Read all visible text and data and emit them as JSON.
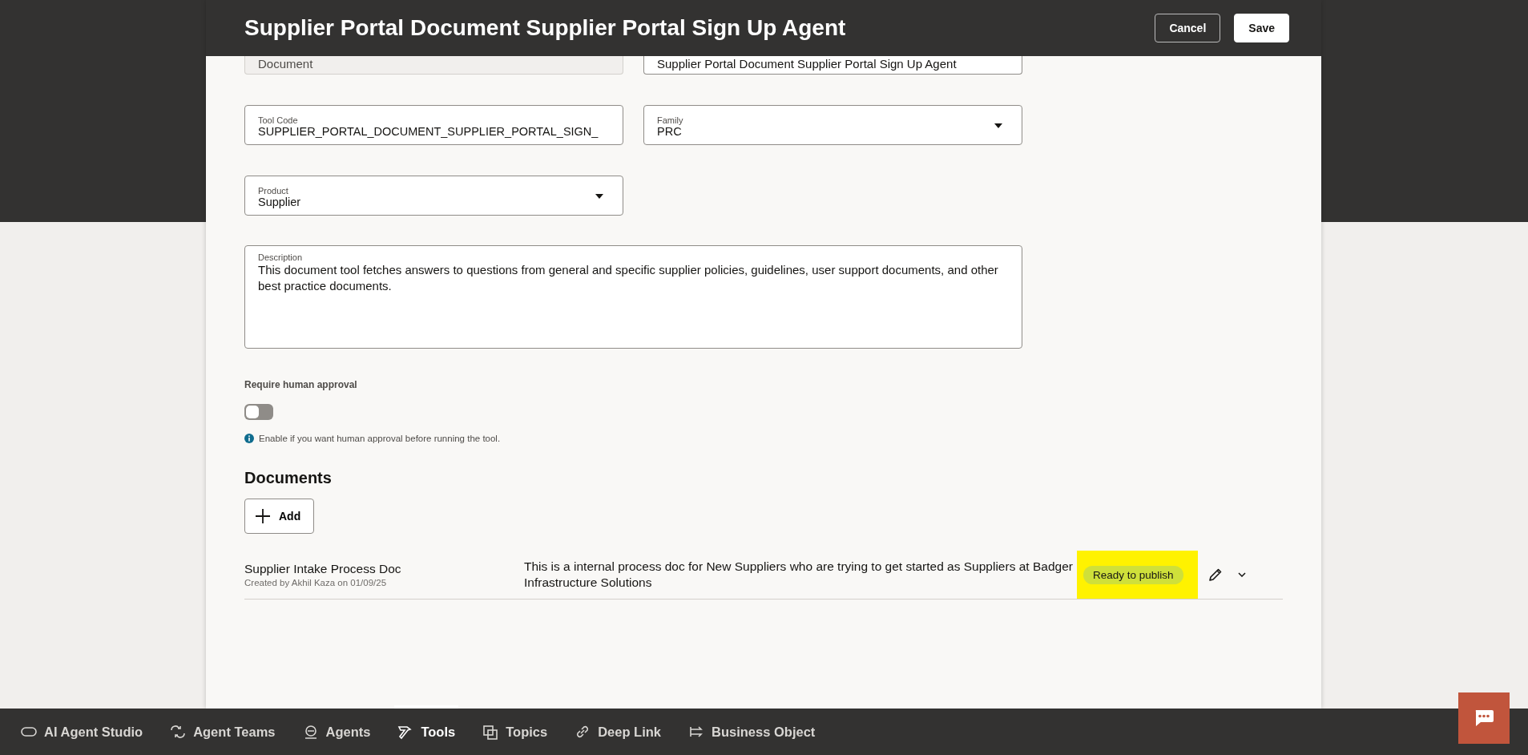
{
  "header": {
    "title": "Supplier Portal Document Supplier Portal Sign Up Agent",
    "buttons": [
      {
        "label": "Cancel",
        "kind": "secondary"
      },
      {
        "label": "Save",
        "kind": "primary"
      }
    ]
  },
  "cut_fields": [
    {
      "value": "Document",
      "disabled": true
    },
    {
      "value": "Supplier Portal Document Supplier Portal Sign Up Agent",
      "disabled": false
    }
  ],
  "fields": [
    {
      "label": "Tool Code",
      "value": "SUPPLIER_PORTAL_DOCUMENT_SUPPLIER_PORTAL_SIGN_",
      "kind": "text"
    },
    {
      "label": "Family",
      "value": "PRC",
      "kind": "select"
    },
    {
      "label": "Product",
      "value": "Supplier",
      "kind": "select"
    }
  ],
  "description": {
    "label": "Description",
    "value": "This document tool fetches answers to questions from general and specific supplier policies, guidelines, user support documents, and other best practice documents."
  },
  "approval": {
    "label": "Require human approval",
    "on": false,
    "hint": "Enable if you want human approval before running the tool."
  },
  "documents": {
    "heading": "Documents",
    "add_label": "Add",
    "rows": [
      {
        "name": "Supplier Intake Process Doc",
        "meta": "Created by Akhil Kaza on 01/09/25",
        "description": "This is a internal process doc for New Suppliers who are trying to get started as Suppliers at Badger Infrastructure Solutions",
        "status": "Ready to publish",
        "highlighted": true
      }
    ]
  },
  "nav": [
    {
      "label": "AI Agent Studio",
      "kind": "studio",
      "selected": false
    },
    {
      "label": "Agent Teams",
      "kind": "teams",
      "selected": false
    },
    {
      "label": "Agents",
      "kind": "agent",
      "selected": false
    },
    {
      "label": "Tools",
      "kind": "tools",
      "selected": true
    },
    {
      "label": "Topics",
      "kind": "topics",
      "selected": false
    },
    {
      "label": "Deep Link",
      "kind": "link",
      "selected": false
    },
    {
      "label": "Business Object",
      "kind": "object",
      "selected": false
    }
  ]
}
